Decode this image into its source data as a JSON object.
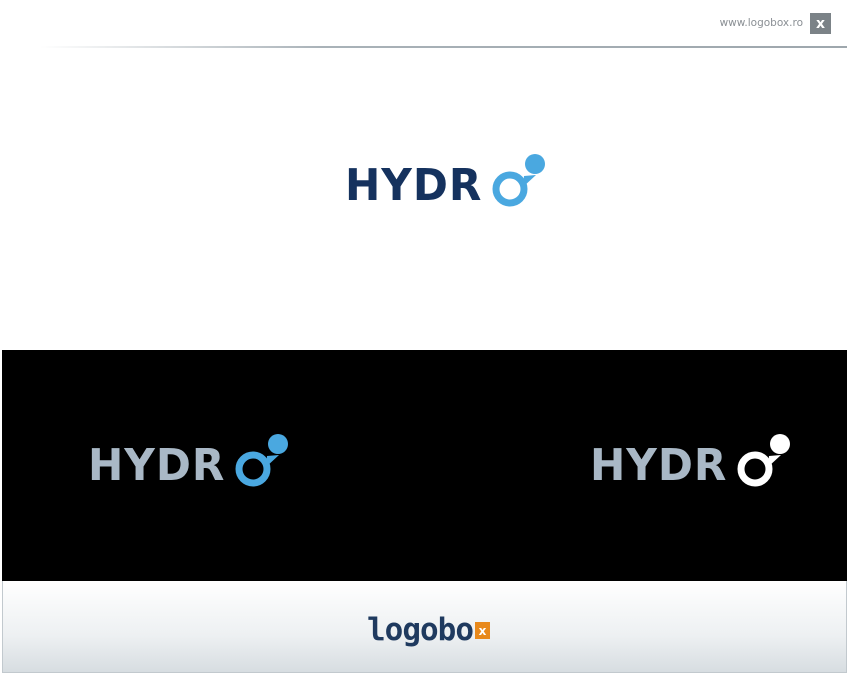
{
  "header": {
    "site_url": "www.logobox.ro",
    "close_label": "x"
  },
  "logo": {
    "wordmark": "HYDR",
    "mark_icon": "water-drop-o-icon",
    "colors": {
      "primary_text": "#15325e",
      "accent_blue": "#4aa8e0",
      "reversed_text": "#a9b8c6",
      "reversed_mark_mono": "#ffffff"
    }
  },
  "variants": {
    "on_white": {
      "wordmark": "HYDR"
    },
    "on_black_color": {
      "wordmark": "HYDR"
    },
    "on_black_mono": {
      "wordmark": "HYDR"
    }
  },
  "footer": {
    "brand": "logobo",
    "brand_badge": "x",
    "colors": {
      "brand_text": "#1f3a5f",
      "badge_bg": "#e8891c"
    }
  }
}
